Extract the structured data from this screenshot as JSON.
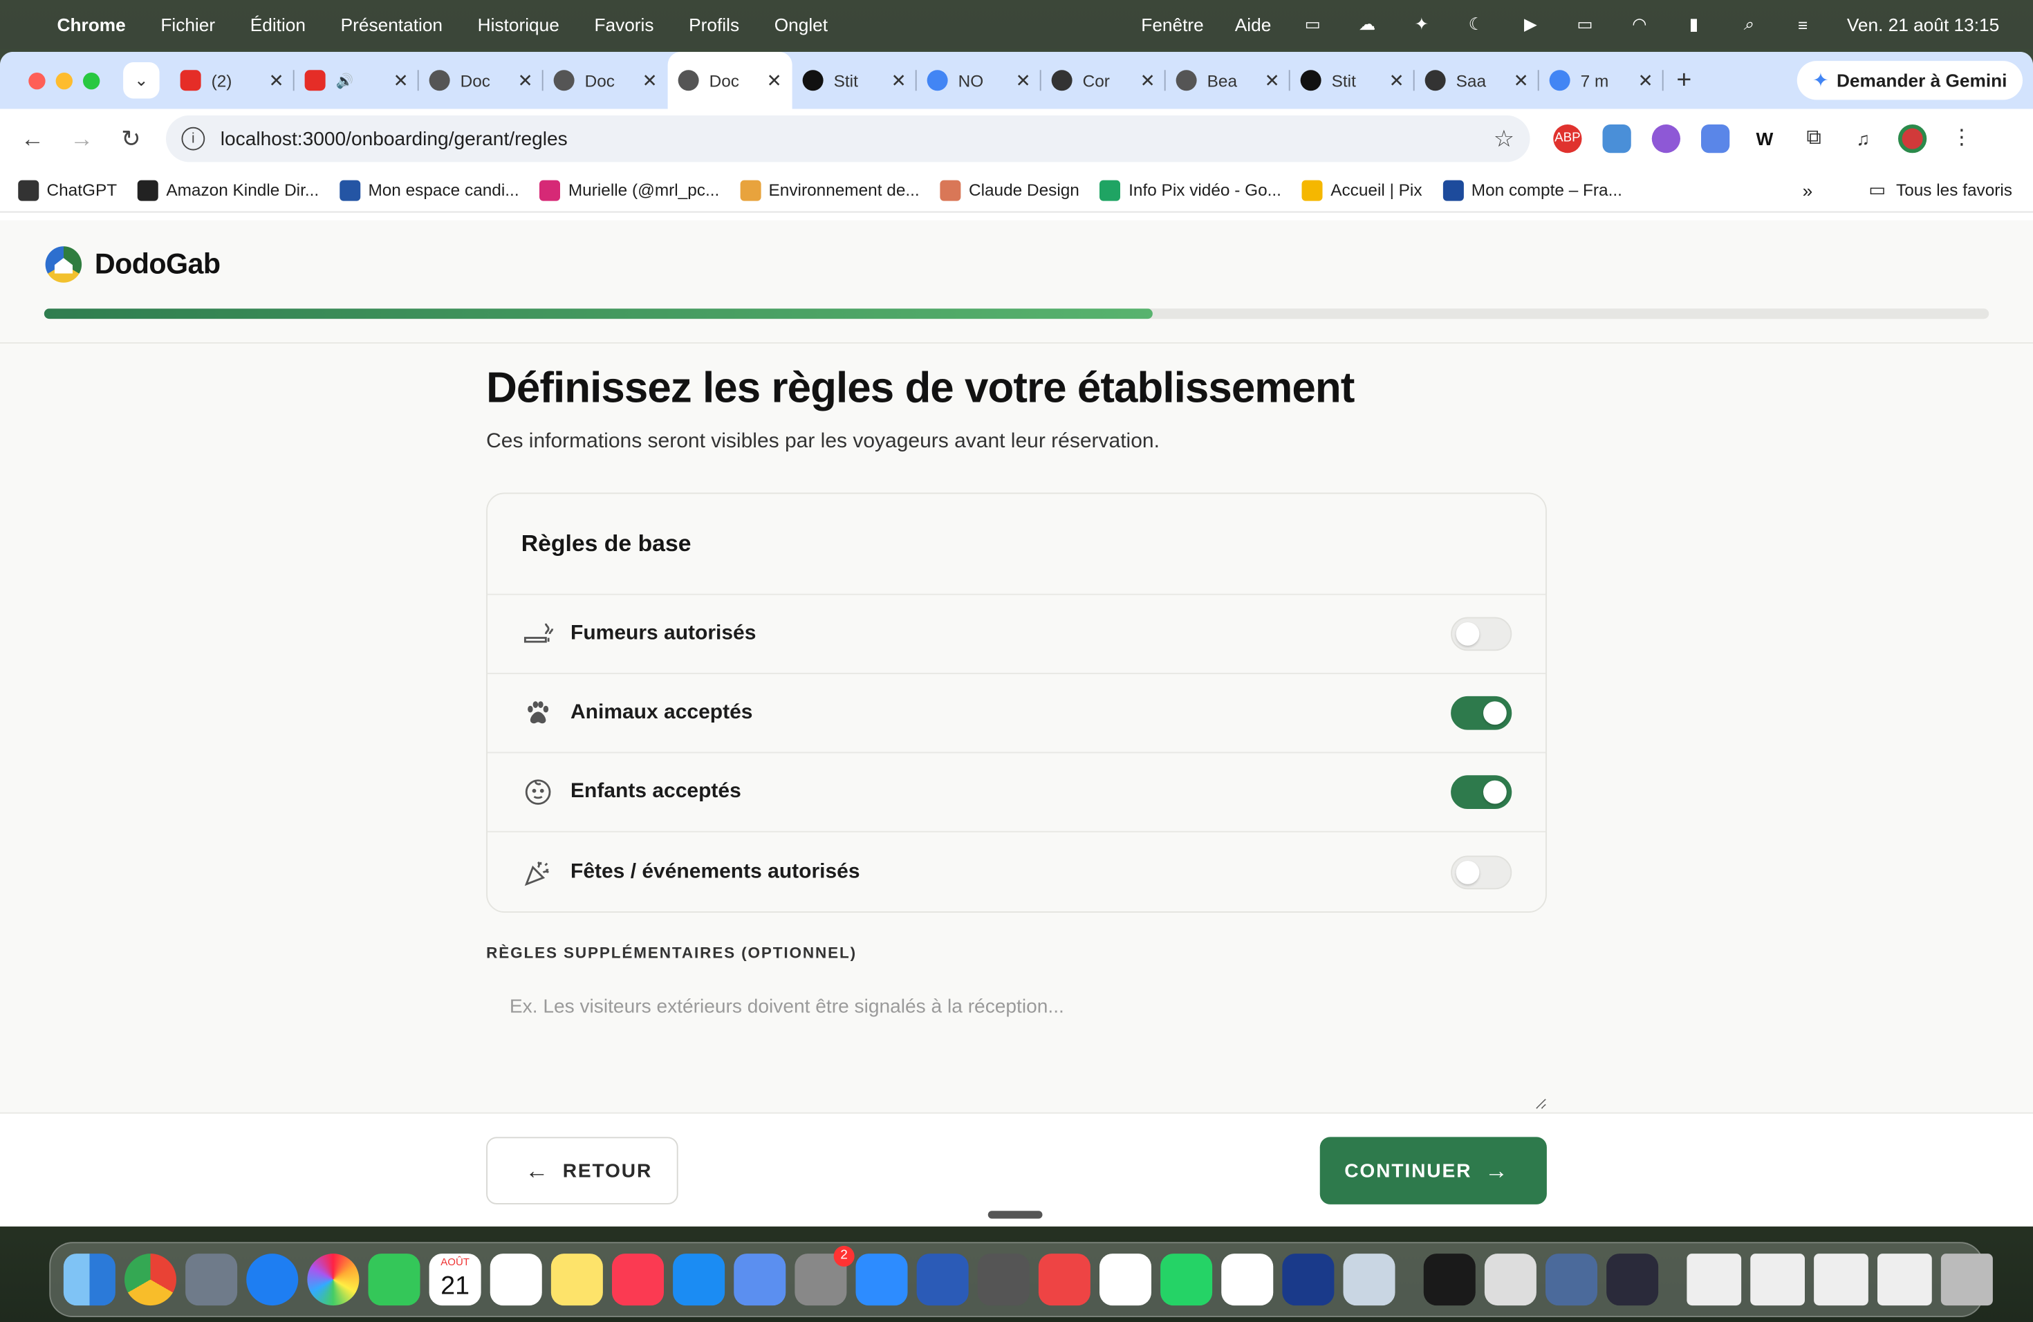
{
  "menubar": {
    "app": "Chrome",
    "menus": [
      "Fichier",
      "Édition",
      "Présentation",
      "Historique",
      "Favoris",
      "Profils",
      "Onglet"
    ],
    "right_menus": [
      "Fenêtre",
      "Aide"
    ],
    "datetime": "Ven. 21 août  13:15"
  },
  "tabs": [
    {
      "title": "(2)",
      "icon": "youtube-icon"
    },
    {
      "title": "",
      "icon": "youtube-icon"
    },
    {
      "title": "Doc",
      "icon": "globe-icon"
    },
    {
      "title": "Doc",
      "icon": "globe-icon"
    },
    {
      "title": "Doc",
      "icon": "globe-icon",
      "active": true
    },
    {
      "title": "Stit",
      "icon": "stitch-icon"
    },
    {
      "title": "NO",
      "icon": "docs-icon"
    },
    {
      "title": "Cor",
      "icon": "chatgpt-icon"
    },
    {
      "title": "Bea",
      "icon": "globe-icon"
    },
    {
      "title": "Stit",
      "icon": "stitch-icon"
    },
    {
      "title": "Saa",
      "icon": "chatgpt-icon"
    },
    {
      "title": "7 m",
      "icon": "google-icon"
    }
  ],
  "gemini_label": "Demander à Gemini",
  "url": "localhost:3000/onboarding/gerant/regles",
  "bookmarks": [
    "ChatGPT",
    "Amazon Kindle Dir...",
    "Mon espace candi...",
    "Murielle (@mrl_pc...",
    "Environnement de...",
    "Claude Design",
    "Info Pix vidéo - Go...",
    "Accueil | Pix",
    "Mon compte – Fra..."
  ],
  "all_bookmarks": "Tous les favoris",
  "brand": {
    "name": "DodoGab"
  },
  "progress": 0.57,
  "heading": "Définissez les règles de votre établissement",
  "subheading": "Ces informations seront visibles par les voyageurs avant leur réservation.",
  "rules_card": {
    "title": "Règles de base",
    "rules": [
      {
        "label": "Fumeurs autorisés",
        "icon": "smoking-icon",
        "enabled": false
      },
      {
        "label": "Animaux acceptés",
        "icon": "paw-icon",
        "enabled": true
      },
      {
        "label": "Enfants acceptés",
        "icon": "child-face-icon",
        "enabled": true
      },
      {
        "label": "Fêtes / événements autorisés",
        "icon": "party-icon",
        "enabled": false
      }
    ]
  },
  "extra_rules": {
    "label": "RÈGLES SUPPLÉMENTAIRES (OPTIONNEL)",
    "placeholder": "Ex. Les visiteurs extérieurs doivent être signalés à la réception...",
    "value": ""
  },
  "buttons": {
    "back": "RETOUR",
    "next": "CONTINUER"
  },
  "dock": {
    "calendar_month": "AOÛT",
    "calendar_day": "21",
    "settings_badge": "2"
  },
  "colors": {
    "accent": "#2e7a4c",
    "progress_end": "#58b36e"
  }
}
